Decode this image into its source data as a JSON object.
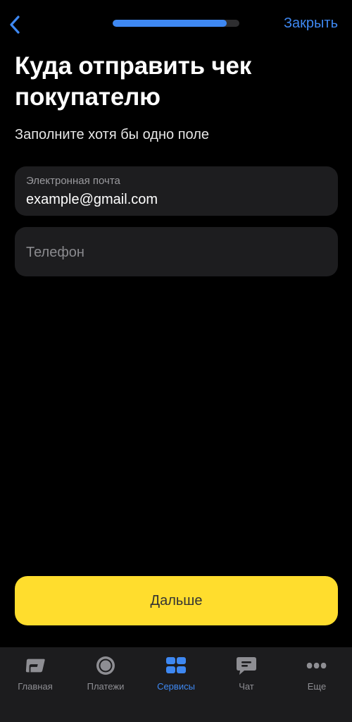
{
  "header": {
    "progress": 0.9,
    "close_label": "Закрыть"
  },
  "main": {
    "title": "Куда отправить чек покупателю",
    "subtitle": "Заполните хотя бы одно поле",
    "email": {
      "label": "Электронная почта",
      "value": "example@gmail.com"
    },
    "phone": {
      "placeholder": "Телефон"
    },
    "next_label": "Дальше"
  },
  "tabbar": {
    "items": [
      {
        "label": "Главная",
        "icon": "home-card-icon",
        "active": false
      },
      {
        "label": "Платежи",
        "icon": "payments-circle-icon",
        "active": false
      },
      {
        "label": "Сервисы",
        "icon": "services-grid-icon",
        "active": true
      },
      {
        "label": "Чат",
        "icon": "chat-bubble-icon",
        "active": false
      },
      {
        "label": "Еще",
        "icon": "more-dots-icon",
        "active": false
      }
    ]
  },
  "colors": {
    "accent": "#3e88f2",
    "button": "#ffdd2d",
    "field_bg": "#1d1d1f",
    "tabbar_bg": "#1c1c1e"
  }
}
